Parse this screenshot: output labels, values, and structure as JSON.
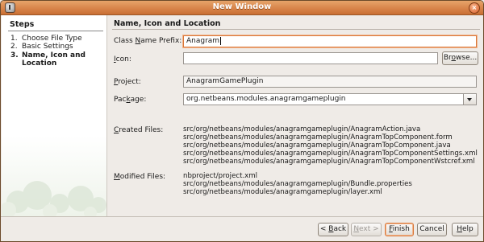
{
  "window": {
    "title": "New Window"
  },
  "sidebar": {
    "heading": "Steps",
    "steps": [
      {
        "num": "1.",
        "label": "Choose File Type"
      },
      {
        "num": "2.",
        "label": "Basic Settings"
      },
      {
        "num": "3.",
        "label": "Name, Icon and Location"
      }
    ]
  },
  "panel": {
    "title": "Name, Icon and Location",
    "class_name_label": "Class Name Prefix:",
    "class_name_value": "Anagram",
    "icon_label": "Icon:",
    "icon_value": "",
    "browse_label": "Browse...",
    "project_label": "Project:",
    "project_value": "AnagramGamePlugin",
    "package_label": "Package:",
    "package_value": "org.netbeans.modules.anagramgameplugin",
    "created_label": "Created Files:",
    "created_files": [
      "src/org/netbeans/modules/anagramgameplugin/AnagramAction.java",
      "src/org/netbeans/modules/anagramgameplugin/AnagramTopComponent.form",
      "src/org/netbeans/modules/anagramgameplugin/AnagramTopComponent.java",
      "src/org/netbeans/modules/anagramgameplugin/AnagramTopComponentSettings.xml",
      "src/org/netbeans/modules/anagramgameplugin/AnagramTopComponentWstcref.xml"
    ],
    "modified_label": "Modified Files:",
    "modified_files": [
      "nbproject/project.xml",
      "src/org/netbeans/modules/anagramgameplugin/Bundle.properties",
      "src/org/netbeans/modules/anagramgameplugin/layer.xml"
    ]
  },
  "buttons": {
    "back": "< Back",
    "next": "Next >",
    "finish": "Finish",
    "cancel": "Cancel",
    "help": "Help"
  }
}
